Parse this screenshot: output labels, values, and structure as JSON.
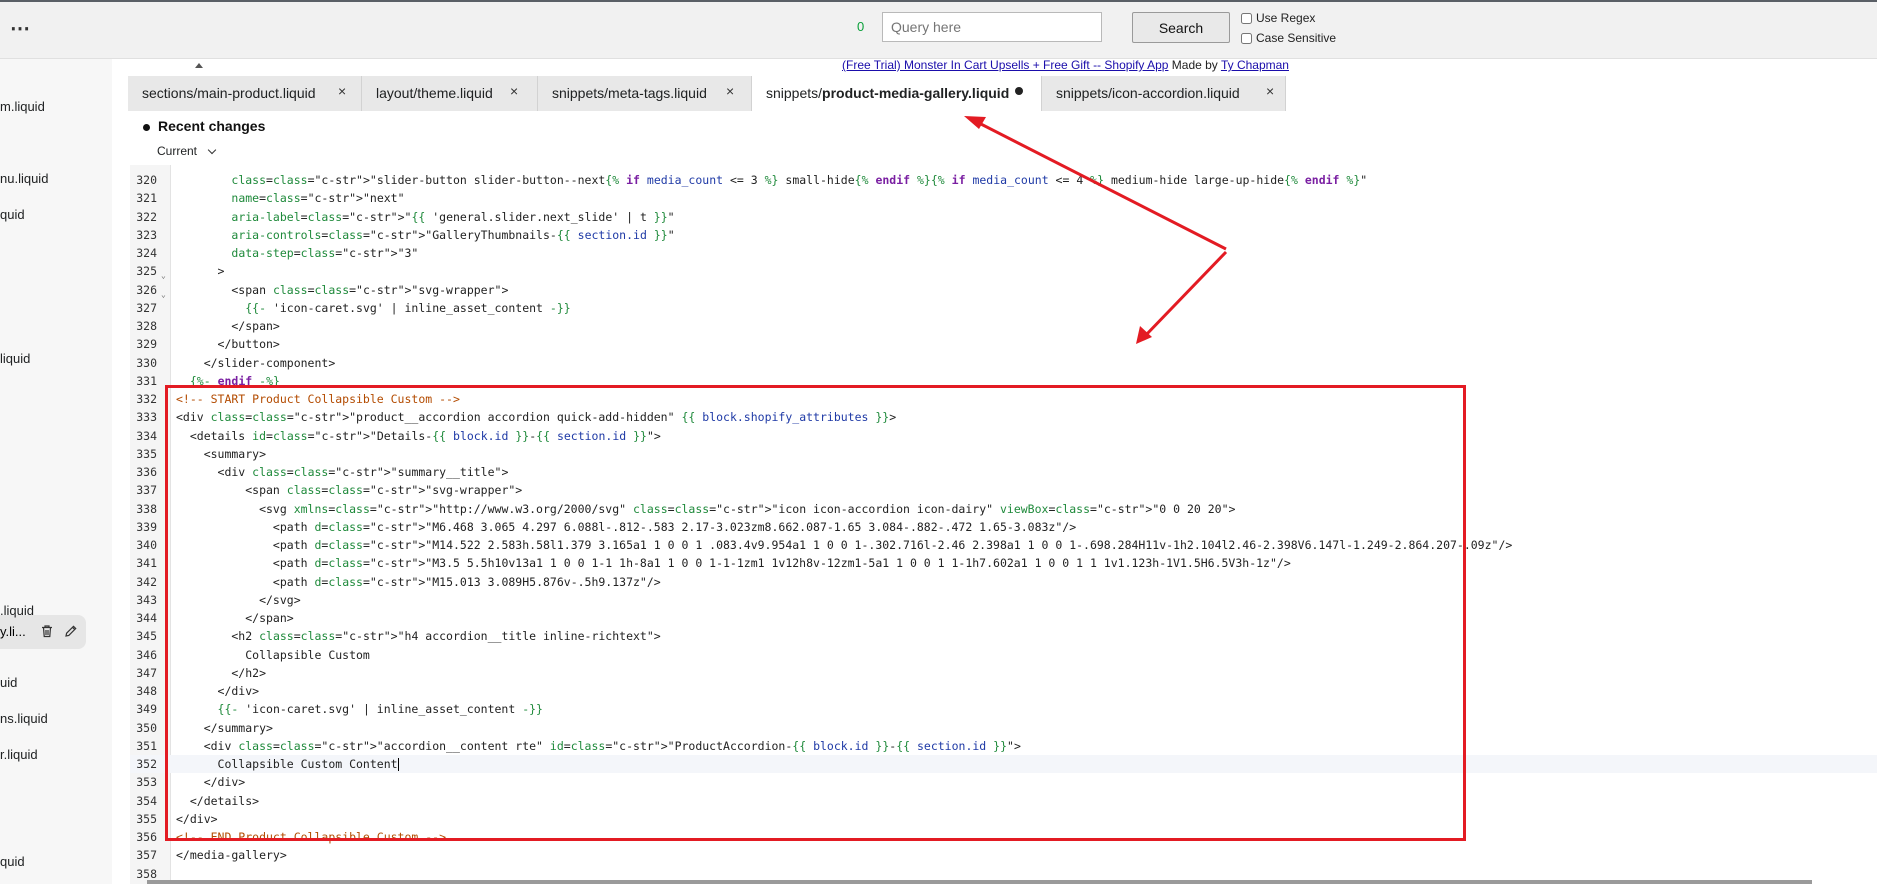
{
  "toolbar": {
    "more_label": "⋯",
    "match_count": "0",
    "query_placeholder": "Query here",
    "query_value": "",
    "search_label": "Search",
    "use_regex_label": "Use Regex",
    "case_sensitive_label": "Case Sensitive"
  },
  "app_notice": {
    "link_text": "(Free Trial) Monster In Cart Upsells + Free Gift -- Shopify App",
    "made_by_text": "Made by",
    "author_link_text": "Ty Chapman"
  },
  "sidebar": {
    "items": [
      {
        "label": "m.liquid"
      },
      {
        "label": "nu.liquid"
      },
      {
        "label": "quid"
      },
      {
        "label": "liquid"
      },
      {
        "label": "y.li..."
      },
      {
        "label": ".liquid"
      },
      {
        "label": "uid"
      },
      {
        "label": "ns.liquid"
      },
      {
        "label": "r.liquid"
      },
      {
        "label": "quid"
      }
    ]
  },
  "tabs": [
    {
      "prefix": "sections/main-product.liquid",
      "bold": "",
      "close": "×"
    },
    {
      "prefix": "layout/theme.liquid",
      "bold": "",
      "close": "×"
    },
    {
      "prefix": "snippets/meta-tags.liquid",
      "bold": "",
      "close": "×"
    },
    {
      "prefix": "snippets/",
      "bold": "product-media-gallery.liquid",
      "close": ""
    },
    {
      "prefix": "snippets/icon-accordion.liquid",
      "bold": "",
      "close": "×"
    }
  ],
  "recent_changes": {
    "title": "Recent changes",
    "version": "Current"
  },
  "editor": {
    "lines": [
      {
        "n": "320",
        "t": "        class=\"slider-button slider-button--next{% if media_count <= 3 %} small-hide{% endif %}{% if media_count <= 4 %} medium-hide large-up-hide{% endif %}\""
      },
      {
        "n": "321",
        "t": "        name=\"next\""
      },
      {
        "n": "322",
        "t": "        aria-label=\"{{ 'general.slider.next_slide' | t }}\""
      },
      {
        "n": "323",
        "t": "        aria-controls=\"GalleryThumbnails-{{ section.id }}\""
      },
      {
        "n": "324",
        "t": "        data-step=\"3\""
      },
      {
        "n": "325",
        "t": "      >"
      },
      {
        "n": "326",
        "t": "        <span class=\"svg-wrapper\">"
      },
      {
        "n": "327",
        "t": "          {{- 'icon-caret.svg' | inline_asset_content -}}"
      },
      {
        "n": "328",
        "t": "        </span>"
      },
      {
        "n": "329",
        "t": "      </button>"
      },
      {
        "n": "330",
        "t": "    </slider-component>"
      },
      {
        "n": "331",
        "t": "  {%- endif -%}"
      },
      {
        "n": "332",
        "t": "<!-- START Product Collapsible Custom -->"
      },
      {
        "n": "333",
        "t": "<div class=\"product__accordion accordion quick-add-hidden\" {{ block.shopify_attributes }}>"
      },
      {
        "n": "334",
        "t": "  <details id=\"Details-{{ block.id }}-{{ section.id }}\">"
      },
      {
        "n": "335",
        "t": "    <summary>"
      },
      {
        "n": "336",
        "t": "      <div class=\"summary__title\">"
      },
      {
        "n": "337",
        "t": "          <span class=\"svg-wrapper\">"
      },
      {
        "n": "338",
        "t": "            <svg xmlns=\"http://www.w3.org/2000/svg\" class=\"icon icon-accordion icon-dairy\" viewBox=\"0 0 20 20\">"
      },
      {
        "n": "339",
        "t": "              <path d=\"M6.468 3.065 4.297 6.088l-.812-.583 2.17-3.023zm8.662.087-1.65 3.084-.882-.472 1.65-3.083z\"/>"
      },
      {
        "n": "340",
        "t": "              <path d=\"M14.522 2.583h.58l1.379 3.165a1 1 0 0 1 .083.4v9.954a1 1 0 0 1-.302.716l-2.46 2.398a1 1 0 0 1-.698.284H11v-1h2.104l2.46-2.398V6.147l-1.249-2.864.207-.09z\"/>"
      },
      {
        "n": "341",
        "t": "              <path d=\"M3.5 5.5h10v13a1 1 0 0 1-1 1h-8a1 1 0 0 1-1-1zm1 1v12h8v-12zm1-5a1 1 0 0 1 1-1h7.602a1 1 0 0 1 1 1v1.123h-1V1.5H6.5V3h-1z\"/>"
      },
      {
        "n": "342",
        "t": "              <path d=\"M15.013 3.089H5.876v-.5h9.137z\"/>"
      },
      {
        "n": "343",
        "t": "            </svg>"
      },
      {
        "n": "344",
        "t": "          </span>"
      },
      {
        "n": "345",
        "t": "        <h2 class=\"h4 accordion__title inline-richtext\">"
      },
      {
        "n": "346",
        "t": "          Collapsible Custom"
      },
      {
        "n": "347",
        "t": "        </h2>"
      },
      {
        "n": "348",
        "t": "      </div>"
      },
      {
        "n": "349",
        "t": "      {{- 'icon-caret.svg' | inline_asset_content -}}"
      },
      {
        "n": "350",
        "t": "    </summary>"
      },
      {
        "n": "351",
        "t": "    <div class=\"accordion__content rte\" id=\"ProductAccordion-{{ block.id }}-{{ section.id }}\">"
      },
      {
        "n": "352",
        "t": "      Collapsible Custom Content"
      },
      {
        "n": "353",
        "t": "    </div>"
      },
      {
        "n": "354",
        "t": "  </details>"
      },
      {
        "n": "355",
        "t": "</div>"
      },
      {
        "n": "356",
        "t": "<!-- END Product Collapsible Custom -->"
      },
      {
        "n": "357",
        "t": "</media-gallery>"
      },
      {
        "n": "358",
        "t": ""
      }
    ]
  },
  "colors": {
    "annotation_red": "#e31b23",
    "match_count_green": "#0aa03a"
  }
}
